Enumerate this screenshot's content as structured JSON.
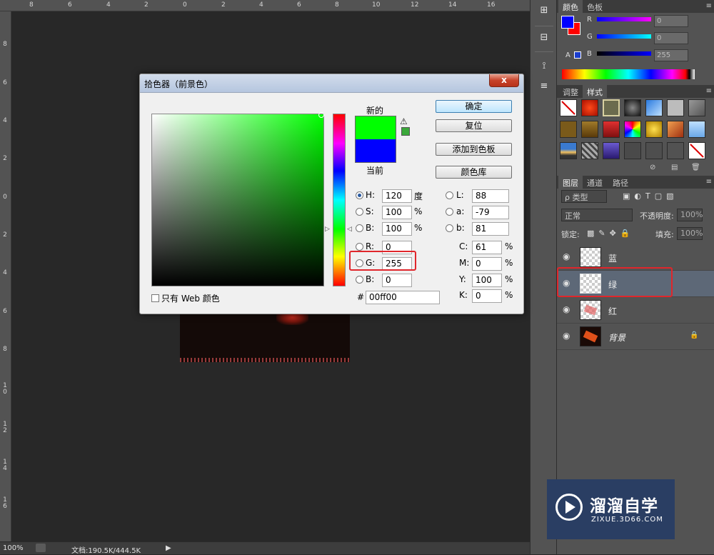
{
  "rulers": {
    "top_ticks": [
      "8",
      "6",
      "4",
      "2",
      "0",
      "2",
      "4",
      "6",
      "8",
      "10",
      "12",
      "14",
      "16"
    ],
    "left_ticks": [
      "8",
      "6",
      "4",
      "2",
      "0",
      "2",
      "4",
      "6",
      "8",
      "10",
      "12",
      "14",
      "16"
    ]
  },
  "status_bar": {
    "zoom": "100%",
    "doc_info": "文档:190.5K/444.5K",
    "arrow": "▶"
  },
  "dialog": {
    "title": "拾色器（前景色）",
    "close": "x",
    "new_label": "新的",
    "current_label": "当前",
    "new_color": "#00ff00",
    "current_color": "#0000ff",
    "gamut_warning_icon": "warning-icon",
    "buttons": {
      "ok": "确定",
      "reset": "复位",
      "add_swatch": "添加到色板",
      "color_library": "颜色库"
    },
    "hsb": {
      "h_label": "H:",
      "h_value": "120",
      "h_unit": "度",
      "s_label": "S:",
      "s_value": "100",
      "s_unit": "%",
      "b_label": "B:",
      "b_value": "100",
      "b_unit": "%"
    },
    "rgb": {
      "r_label": "R:",
      "r_value": "0",
      "g_label": "G:",
      "g_value": "255",
      "b_label": "B:",
      "b_value": "0"
    },
    "lab": {
      "l_label": "L:",
      "l_value": "88",
      "a_label": "a:",
      "a_value": "-79",
      "b_label": "b:",
      "b_value": "81"
    },
    "cmyk": {
      "c_label": "C:",
      "c_value": "61",
      "c_unit": "%",
      "m_label": "M:",
      "m_value": "0",
      "m_unit": "%",
      "y_label": "Y:",
      "y_value": "100",
      "y_unit": "%",
      "k_label": "K:",
      "k_value": "0",
      "k_unit": "%"
    },
    "hex_label": "#",
    "hex_value": "00ff00",
    "web_only_label": "只有 Web 颜色"
  },
  "color_panel": {
    "tabs": [
      "颜色",
      "色板"
    ],
    "r_label": "R",
    "r_value": "0",
    "g_label": "G",
    "g_value": "0",
    "b_label": "B",
    "b_value": "255",
    "fg_color": "#0000ff",
    "bg_color": "#ff0000"
  },
  "styles_panel": {
    "tabs": [
      "调整",
      "样式"
    ]
  },
  "layers_panel": {
    "tabs": [
      "图层",
      "通道",
      "路径"
    ],
    "filter_label": "ρ 类型",
    "blend_mode": "正常",
    "opacity_label": "不透明度:",
    "opacity_value": "100%",
    "lock_label": "锁定:",
    "fill_label": "填充:",
    "fill_value": "100%",
    "layers": [
      {
        "name": "蓝"
      },
      {
        "name": "绿"
      },
      {
        "name": "红"
      },
      {
        "name": "背景"
      }
    ]
  },
  "watermark": {
    "title": "溜溜自学",
    "subtitle": "ZIXUE.3D66.COM"
  }
}
